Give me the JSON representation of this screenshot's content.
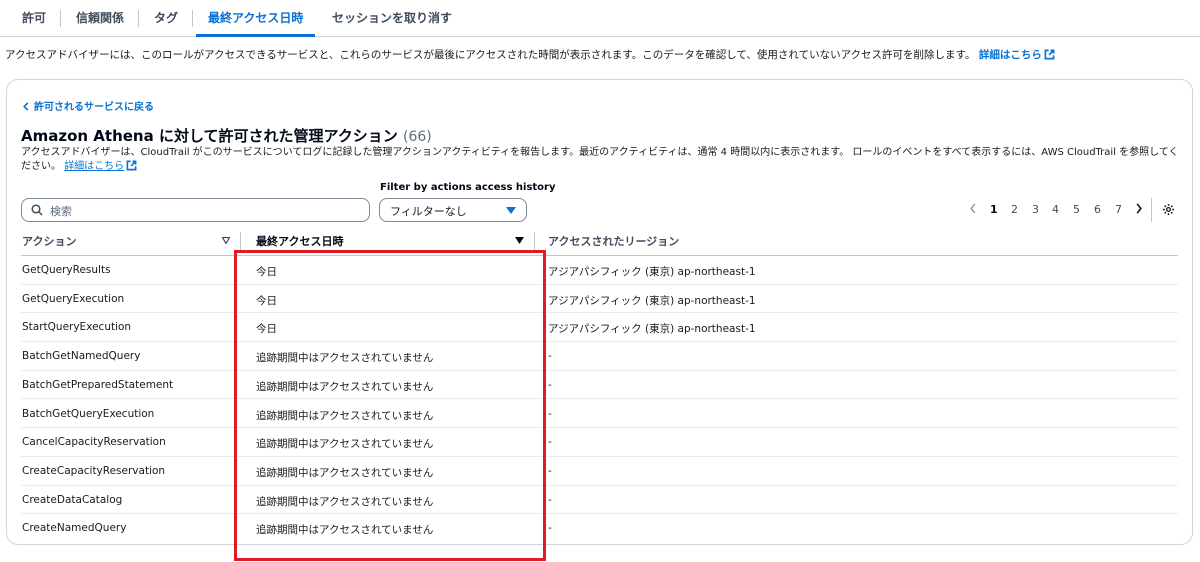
{
  "tabs": [
    {
      "label": "許可",
      "active": false
    },
    {
      "label": "信頼関係",
      "active": false
    },
    {
      "label": "タグ",
      "active": false
    },
    {
      "label": "最終アクセス日時",
      "active": true
    },
    {
      "label": "セッションを取り消す",
      "active": false
    }
  ],
  "intro": {
    "text": "アクセスアドバイザーには、このロールがアクセスできるサービスと、これらのサービスが最後にアクセスされた時間が表示されます。このデータを確認して、使用されていないアクセス許可を削除します。",
    "link": "詳細はこちら"
  },
  "card": {
    "back_link": "許可されるサービスに戻る",
    "title": "Amazon Athena に対して許可された管理アクション",
    "count": "(66)",
    "description": "アクセスアドバイザーは、CloudTrail がこのサービスについてログに記録した管理アクションアクティビティを報告します。最近のアクティビティは、通常 4 時間以内に表示されます。 ロールのイベントをすべて表示するには、AWS CloudTrail を参照してください。",
    "description_link": "詳細はこちら"
  },
  "filters": {
    "search_placeholder": "検索",
    "filter_label": "Filter by actions access history",
    "filter_value": "フィルターなし"
  },
  "pagination": {
    "pages": [
      "1",
      "2",
      "3",
      "4",
      "5",
      "6",
      "7"
    ],
    "current": "1"
  },
  "table": {
    "columns": [
      "アクション",
      "最終アクセス日時",
      "アクセスされたリージョン"
    ],
    "rows": [
      {
        "action": "GetQueryResults",
        "last_accessed": "今日",
        "region": "アジアパシフィック (東京) ap-northeast-1"
      },
      {
        "action": "GetQueryExecution",
        "last_accessed": "今日",
        "region": "アジアパシフィック (東京) ap-northeast-1"
      },
      {
        "action": "StartQueryExecution",
        "last_accessed": "今日",
        "region": "アジアパシフィック (東京) ap-northeast-1"
      },
      {
        "action": "BatchGetNamedQuery",
        "last_accessed": "追跡期間中はアクセスされていません",
        "region": "-"
      },
      {
        "action": "BatchGetPreparedStatement",
        "last_accessed": "追跡期間中はアクセスされていません",
        "region": "-"
      },
      {
        "action": "BatchGetQueryExecution",
        "last_accessed": "追跡期間中はアクセスされていません",
        "region": "-"
      },
      {
        "action": "CancelCapacityReservation",
        "last_accessed": "追跡期間中はアクセスされていません",
        "region": "-"
      },
      {
        "action": "CreateCapacityReservation",
        "last_accessed": "追跡期間中はアクセスされていません",
        "region": "-"
      },
      {
        "action": "CreateDataCatalog",
        "last_accessed": "追跡期間中はアクセスされていません",
        "region": "-"
      },
      {
        "action": "CreateNamedQuery",
        "last_accessed": "追跡期間中はアクセスされていません",
        "region": "-"
      }
    ]
  },
  "colors": {
    "accent": "#0972d3",
    "highlight": "#e01b24"
  }
}
